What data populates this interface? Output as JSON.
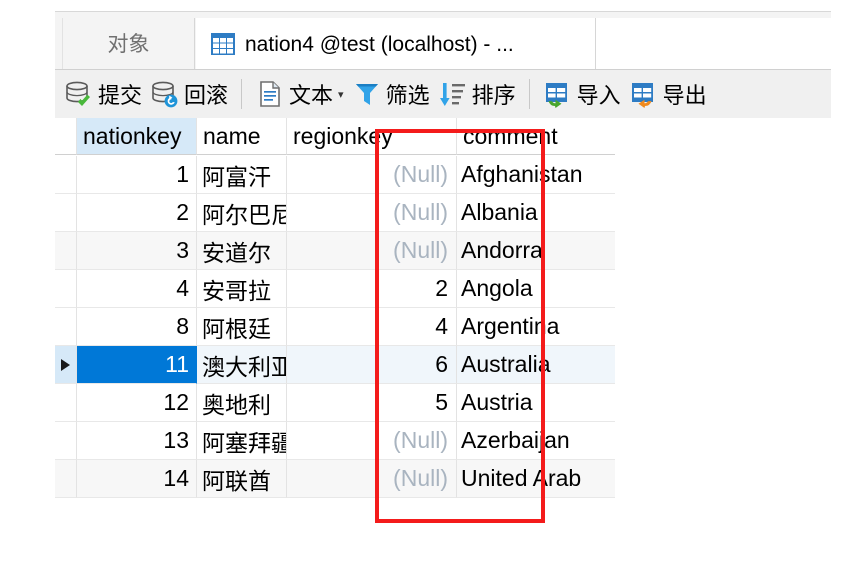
{
  "tabs": {
    "objects_label": "对象",
    "active_label": "nation4 @test (localhost) - ...",
    "active_icon": "table-grid-icon"
  },
  "toolbar": {
    "items": [
      {
        "label": "提交",
        "icon": "commit-database-icon",
        "caret": ""
      },
      {
        "label": "回滚",
        "icon": "rollback-database-icon",
        "caret": ""
      },
      {
        "label": "文本",
        "icon": "text-document-icon",
        "caret": "▾"
      },
      {
        "label": "筛选",
        "icon": "filter-funnel-icon",
        "caret": ""
      },
      {
        "label": "排序",
        "icon": "sort-descending-icon",
        "caret": ""
      },
      {
        "label": "导入",
        "icon": "import-table-icon",
        "caret": ""
      },
      {
        "label": "导出",
        "icon": "export-table-icon",
        "caret": ""
      }
    ]
  },
  "grid": {
    "columns": [
      "nationkey",
      "name",
      "regionkey",
      "comment"
    ],
    "active_column": "nationkey",
    "null_text": "(Null)",
    "row_marker": "▶",
    "selected_row_index": 5,
    "rows": [
      {
        "nationkey": "1",
        "name": "阿富汗",
        "regionkey": "(Null)",
        "comment": "Afghanistan"
      },
      {
        "nationkey": "2",
        "name": "阿尔巴尼亚",
        "regionkey": "(Null)",
        "comment": "Albania"
      },
      {
        "nationkey": "3",
        "name": "安道尔",
        "regionkey": "(Null)",
        "comment": "Andorra"
      },
      {
        "nationkey": "4",
        "name": "安哥拉",
        "regionkey": "2",
        "comment": "Angola"
      },
      {
        "nationkey": "8",
        "name": "阿根廷",
        "regionkey": "4",
        "comment": "Argentina"
      },
      {
        "nationkey": "11",
        "name": "澳大利亚",
        "regionkey": "6",
        "comment": "Australia"
      },
      {
        "nationkey": "12",
        "name": "奥地利",
        "regionkey": "5",
        "comment": "Austria"
      },
      {
        "nationkey": "13",
        "name": "阿塞拜疆",
        "regionkey": "(Null)",
        "comment": "Azerbaijan"
      },
      {
        "nationkey": "14",
        "name": "阿联酋",
        "regionkey": "(Null)",
        "comment": "United Arab"
      }
    ]
  },
  "annotation": {
    "shape": "rectangle",
    "color": "#f41b1b",
    "target_column": "regionkey"
  },
  "colors": {
    "selection_blue": "#0078d7",
    "active_column_blue": "#d6e9f8",
    "null_grey": "#a9b4c0",
    "annotation_red": "#f41b1b"
  }
}
